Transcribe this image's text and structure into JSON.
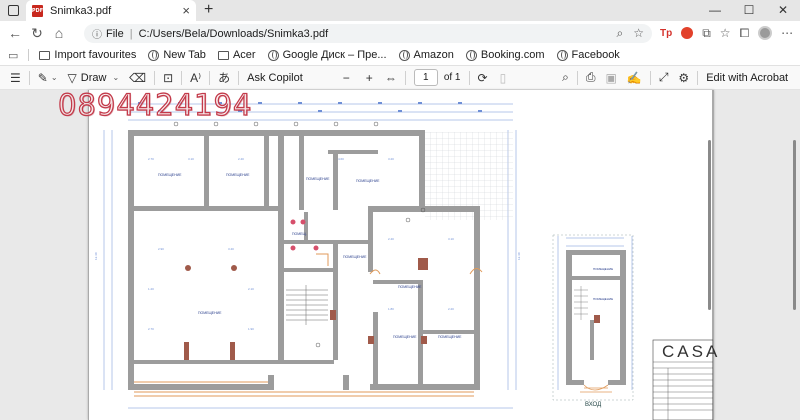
{
  "browser": {
    "tab_title": "Snimka3.pdf",
    "tab_badge": "PDF",
    "new_tab_symbol": "+",
    "address_prefix": "File",
    "url": "C:/Users/Bela/Downloads/Snimka3.pdf",
    "window_buttons": [
      "—",
      "☐",
      "✕"
    ]
  },
  "bookmarks": [
    {
      "label": "Import favourites",
      "icon": "folder-icon"
    },
    {
      "label": "New Tab",
      "icon": "globe-icon"
    },
    {
      "label": "Acer",
      "icon": "folder-icon"
    },
    {
      "label": "Google Диск – Пре...",
      "icon": "globe-icon"
    },
    {
      "label": "Amazon",
      "icon": "globe-icon"
    },
    {
      "label": "Booking.com",
      "icon": "globe-icon"
    },
    {
      "label": "Facebook",
      "icon": "globe-icon"
    }
  ],
  "pdf_toolbar": {
    "draw_label": "Draw",
    "ask_copilot": "Ask Copilot",
    "zoom_out": "−",
    "zoom_in": "+",
    "page_number": "1",
    "page_of": "of 1",
    "edit_acrobat": "Edit with Acrobat"
  },
  "document": {
    "watermark_phone": "0894424194",
    "logo_text": "CASA",
    "entrance_label": "ВХОД"
  },
  "colors": {
    "wall_gray": "#9c9c9c",
    "dimension_blue": "#6f8fd6",
    "label_blue": "#2a3f8c",
    "watermark_red": "#c33a4a",
    "furniture_brown": "#a05a4a"
  }
}
